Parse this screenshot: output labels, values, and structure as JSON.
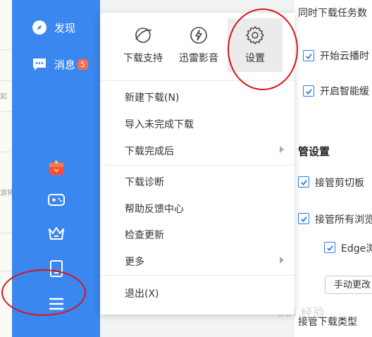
{
  "left_strip": {
    "text_1": "如",
    "text_2": "游将"
  },
  "sidebar": {
    "discover_label": "发现",
    "messages_label": "消息",
    "messages_badge": "5"
  },
  "menu": {
    "tiles": [
      {
        "label": "下载支持",
        "icon": "download-support-icon"
      },
      {
        "label": "迅雷影音",
        "icon": "xunlei-player-icon"
      },
      {
        "label": "设置",
        "icon": "gear-icon"
      }
    ],
    "items": [
      {
        "label": "新建下载(N)"
      },
      {
        "label": "导入未完成下载"
      },
      {
        "label": "下载完成后"
      },
      {
        "label": "下载诊断"
      },
      {
        "label": "帮助反馈中心"
      },
      {
        "label": "检查更新"
      },
      {
        "label": "更多"
      },
      {
        "label": "退出(X)"
      }
    ]
  },
  "settings": {
    "top_cut": "同时下载任务数",
    "opt_cloud": "开始云播时",
    "opt_smart": "开启智能缓",
    "section_title": "管设置",
    "opt_clipboard": "接管剪切板",
    "opt_browsers": "接管所有浏览",
    "opt_edge": "Edge浏",
    "manual_button": "手动更改",
    "bottom_cut": "接管下载类型"
  },
  "watermark": "Bai 经验",
  "colors": {
    "sidebar": "#3a87f0",
    "annotation": "#d8161b",
    "check": "#2f7be6",
    "badge": "#ff6a4d"
  }
}
